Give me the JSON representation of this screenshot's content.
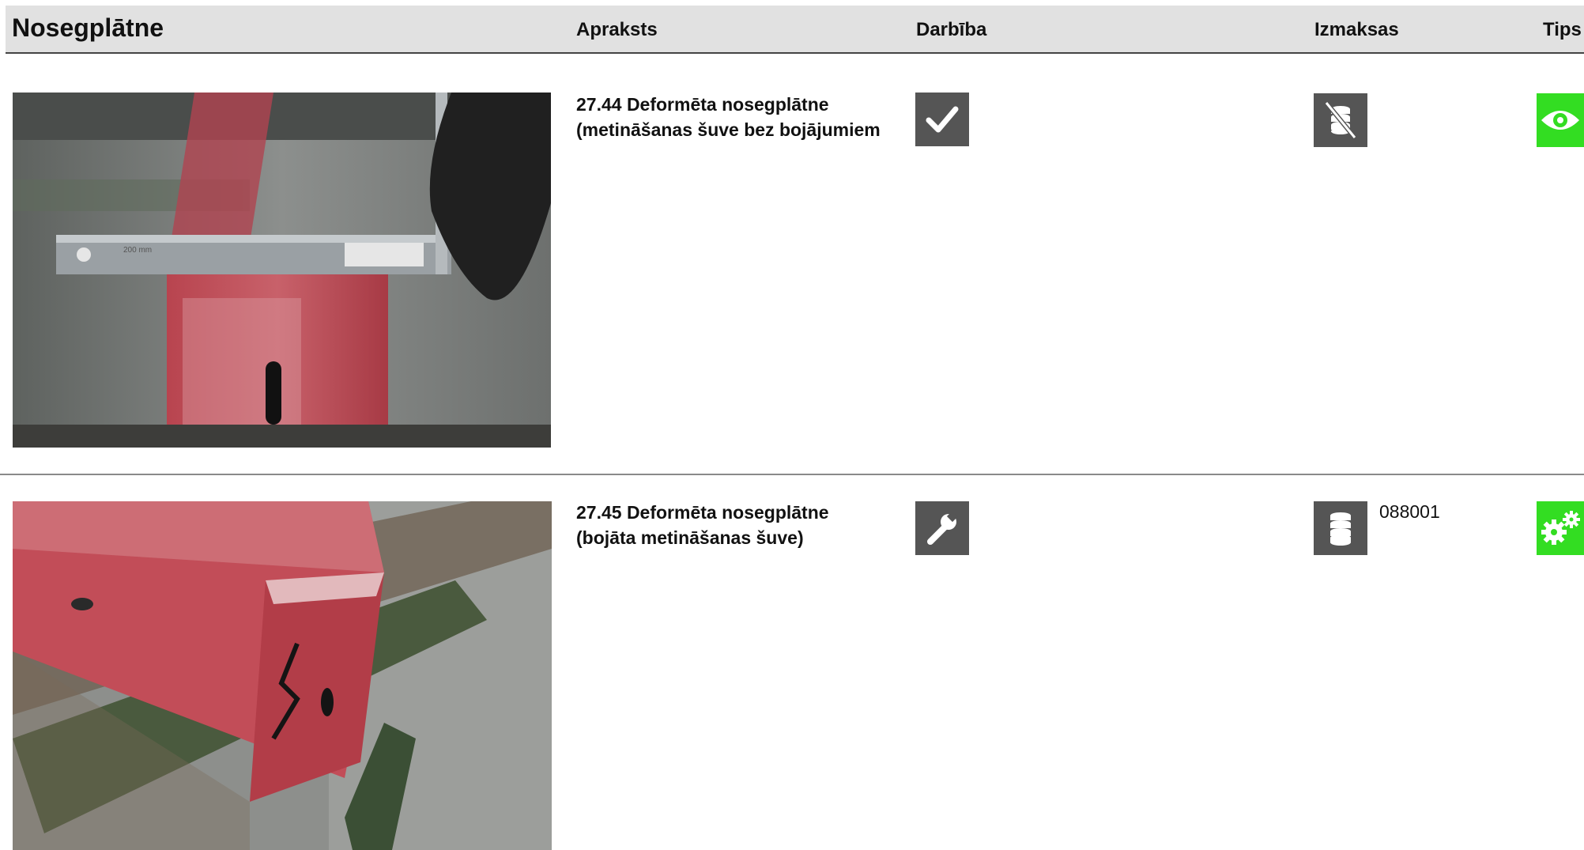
{
  "header": {
    "title": "Nosegplātne",
    "col_description": "Apraksts",
    "col_action": "Darbība",
    "col_costs": "Izmaksas",
    "col_type": "Tips"
  },
  "rows": [
    {
      "description": "27.44 Deformēta nosegplātne\n(metināšanas šuve bez bojājumiem",
      "action_icon": "checkmark-icon",
      "cost_icon": "no-cost-coins-icon",
      "cost_code": "",
      "type_icon": "eye-icon",
      "photo_ruler_text": "200 mm"
    },
    {
      "description": "27.45 Deformēta nosegplātne\n(bojāta metināšanas šuve)",
      "action_icon": "wrench-icon",
      "cost_icon": "coins-icon",
      "cost_code": "088001",
      "type_icon": "gears-icon"
    }
  ],
  "colors": {
    "header_bg": "#e1e1e1",
    "icon_dark": "#555555",
    "icon_green": "#33dd22"
  }
}
